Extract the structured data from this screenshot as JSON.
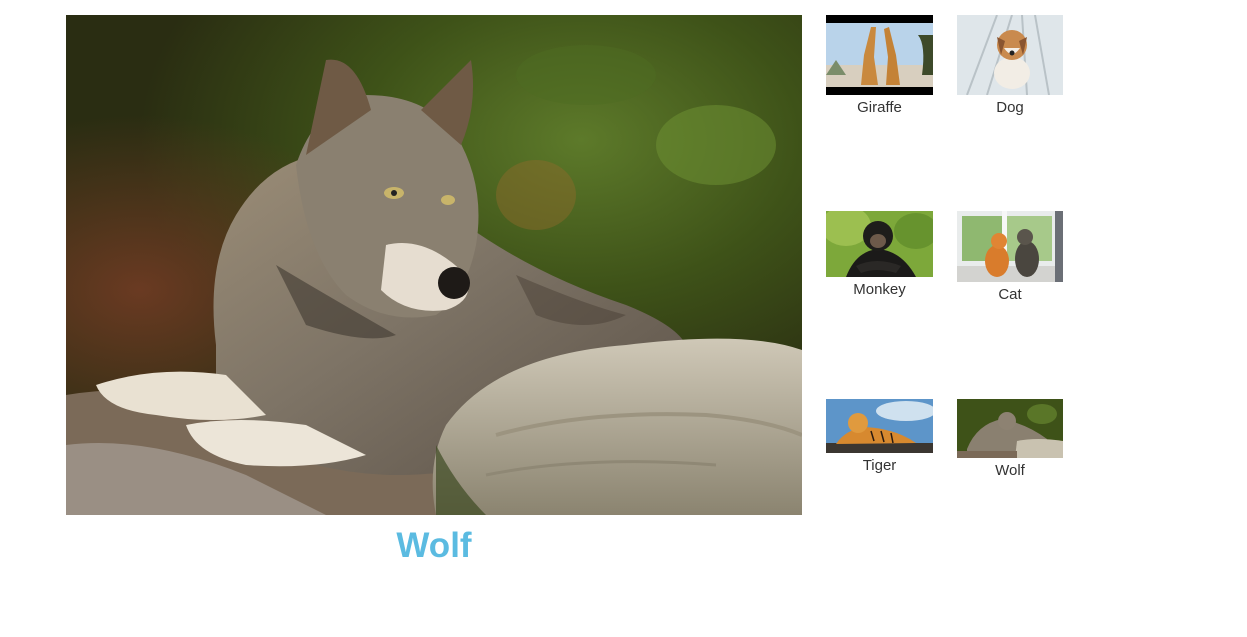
{
  "main": {
    "caption": "Wolf",
    "image_subject": "wolf-photo"
  },
  "gallery": [
    {
      "label": "Giraffe"
    },
    {
      "label": "Dog"
    },
    {
      "label": "Monkey"
    },
    {
      "label": "Cat"
    },
    {
      "label": "Tiger"
    },
    {
      "label": "Wolf"
    }
  ],
  "colors": {
    "caption": "#5bbbe1",
    "label": "#333333",
    "background": "#ffffff"
  }
}
